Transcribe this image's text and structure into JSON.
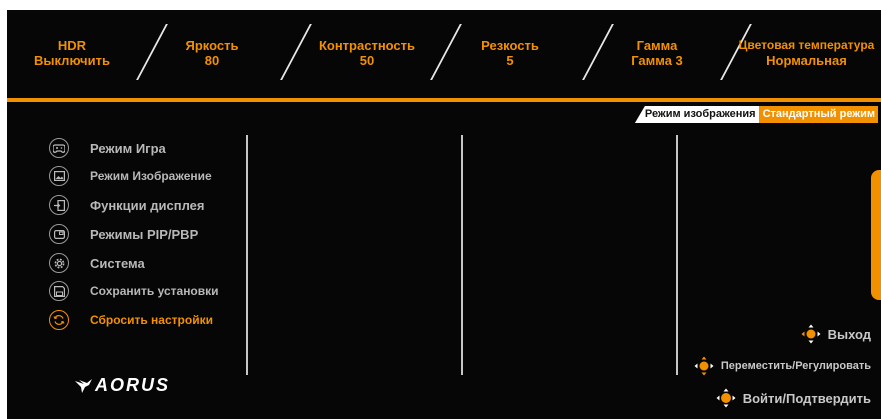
{
  "status_bar": [
    {
      "name": "HDR",
      "value": "Выключить"
    },
    {
      "name": "Яркость",
      "value": "80"
    },
    {
      "name": "Контрастность",
      "value": "50"
    },
    {
      "name": "Резкость",
      "value": "5"
    },
    {
      "name": "Гамма",
      "value": "Гамма 3"
    },
    {
      "name": "Цветовая температура",
      "value": "Нормальная"
    }
  ],
  "mode": {
    "label": "Режим изображения",
    "value": "Стандартный режим"
  },
  "menu": [
    {
      "label": "Режим Игра",
      "icon": "gamepad-icon"
    },
    {
      "label": "Режим Изображение",
      "icon": "picture-icon"
    },
    {
      "label": "Функции дисплея",
      "icon": "display-input-icon"
    },
    {
      "label": "Режимы PIP/PBP",
      "icon": "pip-icon"
    },
    {
      "label": "Система",
      "icon": "gear-icon"
    },
    {
      "label": "Сохранить установки",
      "icon": "save-icon"
    },
    {
      "label": "Сбросить настройки",
      "icon": "reset-icon",
      "active": true
    }
  ],
  "hints": [
    {
      "label": "Выход",
      "icon": "joystick-left-icon"
    },
    {
      "label": "Переместить/Регулировать",
      "icon": "joystick-move-icon"
    },
    {
      "label": "Войти/Подтвердить",
      "icon": "joystick-press-icon"
    }
  ],
  "brand": {
    "logo": "AORUS"
  },
  "colors": {
    "accent": "#f29100",
    "background": "#060606",
    "text": "#b8b8b8"
  }
}
